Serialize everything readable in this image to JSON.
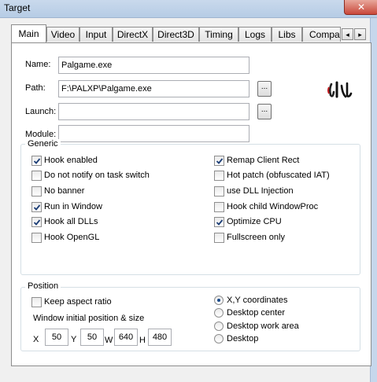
{
  "window": {
    "title": "Target",
    "close_glyph": "✕"
  },
  "tabs": [
    {
      "label": "Main",
      "active": true
    },
    {
      "label": "Video"
    },
    {
      "label": "Input"
    },
    {
      "label": "DirectX"
    },
    {
      "label": "Direct3D"
    },
    {
      "label": "Timing"
    },
    {
      "label": "Logs"
    },
    {
      "label": "Libs"
    },
    {
      "label": "Compa"
    }
  ],
  "tab_scroll": {
    "left_icon": "◂",
    "right_icon": "▸"
  },
  "fields": {
    "name": {
      "label": "Name:",
      "value": "Palgame.exe"
    },
    "path": {
      "label": "Path:",
      "value": "F:\\PALXP\\Palgame.exe",
      "browse": "..."
    },
    "launch": {
      "label": "Launch:",
      "value": "",
      "browse": "..."
    },
    "module": {
      "label": "Module:",
      "value": ""
    }
  },
  "logo": {
    "icon": "app-logo-icon"
  },
  "generic": {
    "title": "Generic",
    "left": [
      {
        "label": "Hook enabled",
        "checked": true
      },
      {
        "label": "Do not notify on task switch",
        "checked": false
      },
      {
        "label": "No banner",
        "checked": false
      },
      {
        "label": "Run in Window",
        "checked": true
      },
      {
        "label": "Hook all DLLs",
        "checked": true
      },
      {
        "label": "Hook OpenGL",
        "checked": false
      }
    ],
    "right": [
      {
        "label": "Remap Client Rect",
        "checked": true
      },
      {
        "label": "Hot patch (obfuscated IAT)",
        "checked": false
      },
      {
        "label": "use DLL Injection",
        "checked": false
      },
      {
        "label": "Hook child WindowProc",
        "checked": false
      },
      {
        "label": "Optimize CPU",
        "checked": true
      },
      {
        "label": "Fullscreen only",
        "checked": false
      }
    ]
  },
  "position": {
    "title": "Position",
    "keep_aspect": {
      "label": "Keep aspect ratio",
      "checked": false
    },
    "init_label": "Window initial position & size",
    "x_label": "X",
    "x": "50",
    "y_label": "Y",
    "y": "50",
    "w_label": "W",
    "w": "640",
    "h_label": "H",
    "h": "480",
    "radios": [
      {
        "label": "X,Y coordinates",
        "selected": true
      },
      {
        "label": "Desktop center",
        "selected": false
      },
      {
        "label": "Desktop work area",
        "selected": false
      },
      {
        "label": "Desktop",
        "selected": false
      }
    ]
  }
}
